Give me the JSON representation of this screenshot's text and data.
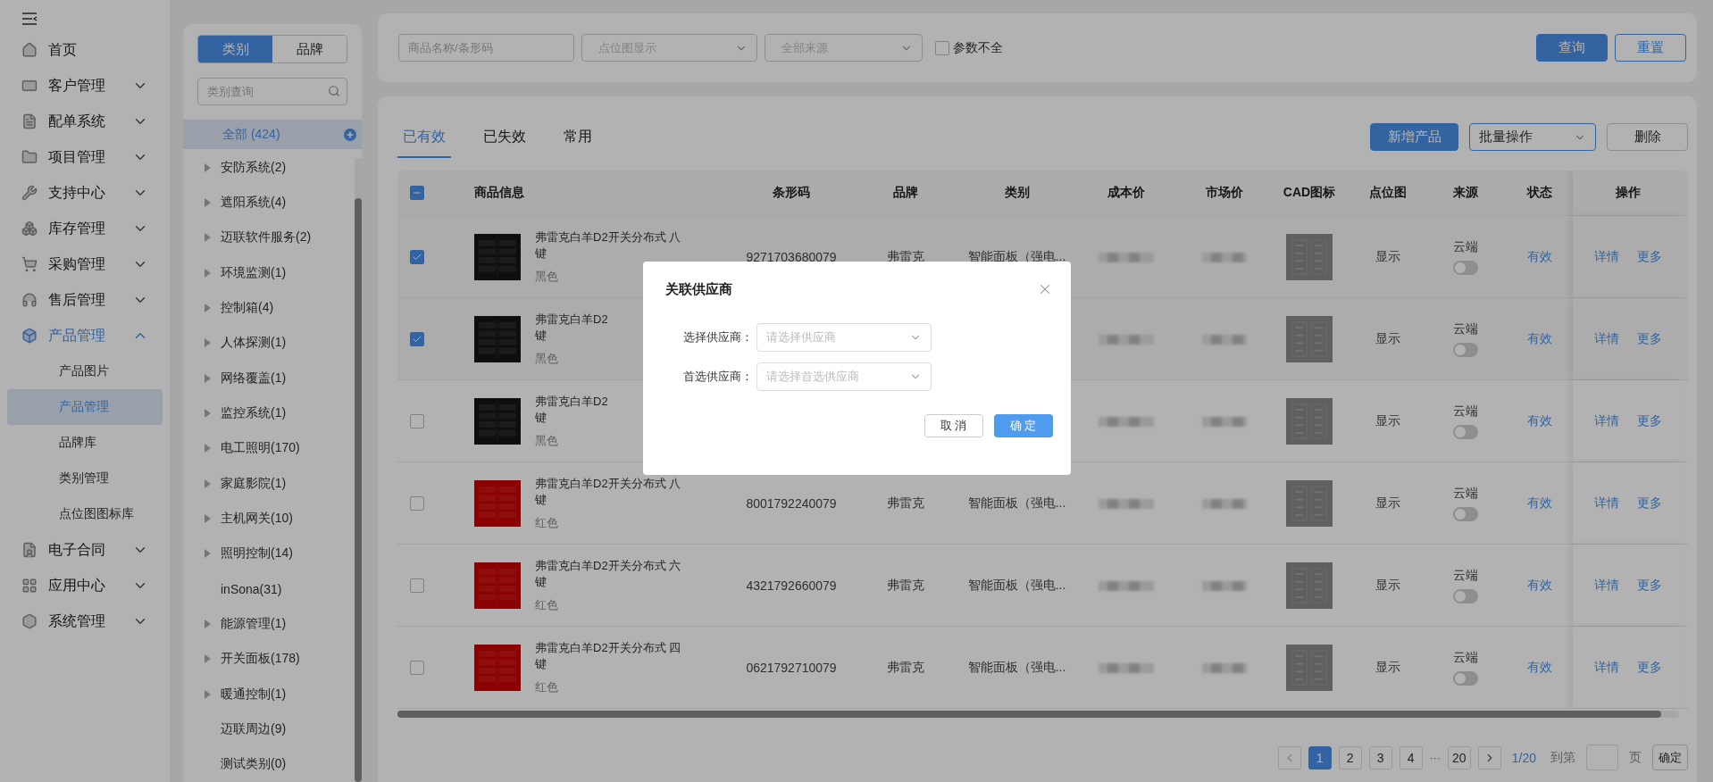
{
  "sidebar": {
    "items": [
      {
        "label": "首页",
        "expandable": false,
        "selected": false
      },
      {
        "label": "客户管理",
        "expandable": true,
        "expanded": false,
        "selected": false
      },
      {
        "label": "配单系统",
        "expandable": true,
        "expanded": false,
        "selected": false
      },
      {
        "label": "项目管理",
        "expandable": true,
        "expanded": false,
        "selected": false
      },
      {
        "label": "支持中心",
        "expandable": true,
        "expanded": false,
        "selected": false
      },
      {
        "label": "库存管理",
        "expandable": true,
        "expanded": false,
        "selected": false
      },
      {
        "label": "采购管理",
        "expandable": true,
        "expanded": false,
        "selected": false
      },
      {
        "label": "售后管理",
        "expandable": true,
        "expanded": false,
        "selected": false
      },
      {
        "label": "产品管理",
        "expandable": true,
        "expanded": true,
        "selected": true,
        "children": [
          {
            "label": "产品图片",
            "selected": false
          },
          {
            "label": "产品管理",
            "selected": true
          },
          {
            "label": "品牌库",
            "selected": false
          },
          {
            "label": "类别管理",
            "selected": false
          },
          {
            "label": "点位图图标库",
            "selected": false
          }
        ]
      },
      {
        "label": "电子合同",
        "expandable": true,
        "expanded": false,
        "selected": false
      },
      {
        "label": "应用中心",
        "expandable": true,
        "expanded": false,
        "selected": false
      },
      {
        "label": "系统管理",
        "expandable": true,
        "expanded": false,
        "selected": false
      }
    ]
  },
  "category_panel": {
    "switch": [
      {
        "label": "类别",
        "selected": true
      },
      {
        "label": "品牌",
        "selected": false
      }
    ],
    "search": {
      "placeholder": "类别查询"
    },
    "all": {
      "label": "全部 (424)",
      "selected": true
    },
    "items": [
      {
        "label": "安防系统(2)",
        "expandable": true
      },
      {
        "label": "遮阳系统(4)",
        "expandable": true
      },
      {
        "label": "迈联软件服务(2)",
        "expandable": true
      },
      {
        "label": "环境监测(1)",
        "expandable": true
      },
      {
        "label": "控制箱(4)",
        "expandable": true
      },
      {
        "label": "人体探测(1)",
        "expandable": true
      },
      {
        "label": "网络覆盖(1)",
        "expandable": true
      },
      {
        "label": "监控系统(1)",
        "expandable": true
      },
      {
        "label": "电工照明(170)",
        "expandable": true
      },
      {
        "label": "家庭影院(1)",
        "expandable": true
      },
      {
        "label": "主机网关(10)",
        "expandable": true
      },
      {
        "label": "照明控制(14)",
        "expandable": true
      },
      {
        "label": "inSona(31)",
        "expandable": false
      },
      {
        "label": "能源管理(1)",
        "expandable": true
      },
      {
        "label": "开关面板(178)",
        "expandable": true
      },
      {
        "label": "暖通控制(1)",
        "expandable": true
      },
      {
        "label": "迈联周边(9)",
        "expandable": false
      },
      {
        "label": "测试类别(0)",
        "expandable": false
      }
    ]
  },
  "filters": {
    "keyword": {
      "placeholder": "商品名称/条形码"
    },
    "point_map": {
      "placeholder": "点位图显示"
    },
    "source": {
      "placeholder": "全部来源"
    },
    "incomplete": {
      "label": "参数不全",
      "checked": false
    },
    "buttons": {
      "query": "查询",
      "reset": "重置"
    }
  },
  "tabs": [
    {
      "label": "已有效",
      "selected": true
    },
    {
      "label": "已失效",
      "selected": false
    },
    {
      "label": "常用",
      "selected": false
    }
  ],
  "toolbar": {
    "add": "新增产品",
    "batch": "批量操作",
    "delete": "删除"
  },
  "table": {
    "select_all": {
      "checked": true,
      "indeterminate": true
    },
    "columns": [
      "商品信息",
      "条形码",
      "品牌",
      "类别",
      "成本价",
      "市场价",
      "CAD图标",
      "点位图",
      "来源",
      "状态",
      "操作"
    ],
    "rows": [
      {
        "checked": true,
        "name_lines": [
          "弗雷克白羊D2开关分布式 八",
          "键"
        ],
        "color_name": "黑色",
        "kind": "black_panel",
        "barcode": "9271703680079",
        "brand": "弗雷克",
        "category": "智能面板（强电...",
        "point_map": "显示",
        "source": "云端",
        "cloud_on": false,
        "status": "有效",
        "actions": [
          "详情",
          "更多"
        ]
      },
      {
        "checked": true,
        "name_lines": [
          "弗雷克白羊D2",
          "键"
        ],
        "color_name": "黑色",
        "kind": "black_panel",
        "point_map": "显示",
        "source": "云端",
        "cloud_on": false,
        "status": "有效",
        "actions": [
          "详情",
          "更多"
        ]
      },
      {
        "checked": false,
        "name_lines": [
          "弗雷克白羊D2",
          "键"
        ],
        "color_name": "黑色",
        "kind": "black_panel",
        "point_map": "显示",
        "source": "云端",
        "cloud_on": false,
        "status": "有效",
        "actions": [
          "详情",
          "更多"
        ]
      },
      {
        "checked": false,
        "name_lines": [
          "弗雷克白羊D2开关分布式 八",
          "键"
        ],
        "color_name": "红色",
        "kind": "red_panel",
        "barcode": "8001792240079",
        "brand": "弗雷克",
        "category": "智能面板（强电...",
        "point_map": "显示",
        "source": "云端",
        "cloud_on": false,
        "status": "有效",
        "actions": [
          "详情",
          "更多"
        ]
      },
      {
        "checked": false,
        "name_lines": [
          "弗雷克白羊D2开关分布式 六",
          "键"
        ],
        "color_name": "红色",
        "kind": "red_panel",
        "barcode": "4321792660079",
        "brand": "弗雷克",
        "category": "智能面板（强电...",
        "point_map": "显示",
        "source": "云端",
        "cloud_on": false,
        "status": "有效",
        "actions": [
          "详情",
          "更多"
        ]
      },
      {
        "checked": false,
        "name_lines": [
          "弗雷克白羊D2开关分布式 四",
          "键"
        ],
        "color_name": "红色",
        "kind": "red_panel",
        "barcode": "0621792710079",
        "brand": "弗雷克",
        "category": "智能面板（强电...",
        "point_map": "显示",
        "source": "云端",
        "cloud_on": false,
        "status": "有效",
        "actions": [
          "详情",
          "更多"
        ]
      }
    ]
  },
  "pagination": {
    "pages": [
      {
        "label": "1",
        "selected": true
      },
      {
        "label": "2",
        "selected": false
      },
      {
        "label": "3",
        "selected": false
      },
      {
        "label": "4",
        "selected": false
      },
      {
        "label": "···",
        "kind": "gap"
      },
      {
        "label": "20",
        "selected": false
      }
    ],
    "info": "1/20",
    "goto_prefix": "到第",
    "goto_suffix": "页",
    "confirm": "确定"
  },
  "dialog": {
    "title": "关联供应商",
    "fields": [
      {
        "label": "选择供应商：",
        "placeholder": "请选择供应商"
      },
      {
        "label": "首选供应商：",
        "placeholder": "请选择首选供应商"
      }
    ],
    "cancel": "取 消",
    "ok": "确 定"
  }
}
